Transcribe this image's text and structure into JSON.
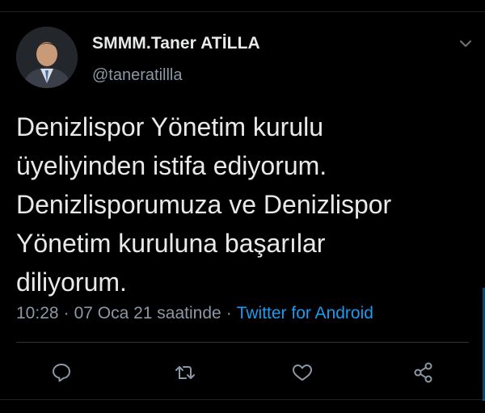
{
  "tweet": {
    "display_name": "SMMM.Taner ATİLLA",
    "handle": "@taneratillla",
    "text_lines": [
      "Denizlispor Yönetim kurulu",
      "üyeliyinden istifa ediyorum.",
      "Denizlisporumuza ve Denizlispor",
      "Yönetim kuruluna başarılar",
      "diliyorum."
    ],
    "time": "10:28",
    "date": "07 Oca 21 saatinde",
    "separator": "·",
    "source": "Twitter for Android"
  },
  "icons": {
    "more": "chevron-down-icon",
    "reply": "reply-icon",
    "retweet": "retweet-icon",
    "like": "like-icon",
    "share": "share-icon"
  },
  "colors": {
    "background": "#000000",
    "text": "#e7e9ea",
    "secondary_text": "#8b98a5",
    "accent": "#1d9bf0"
  }
}
